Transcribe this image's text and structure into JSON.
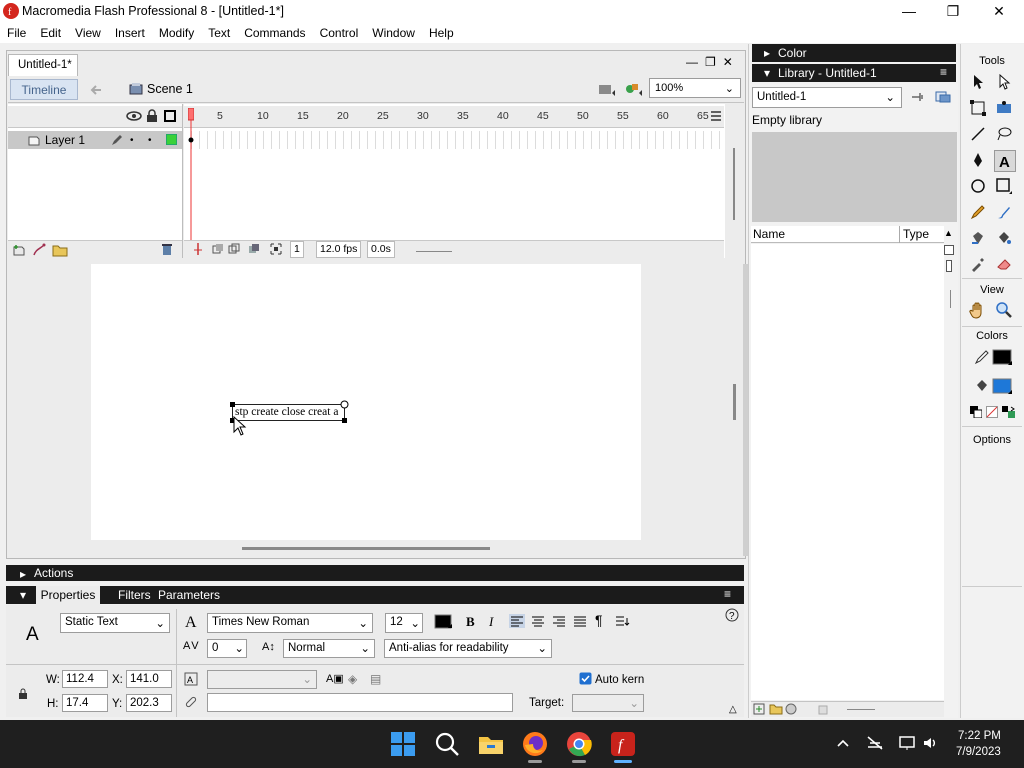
{
  "window": {
    "title": "Macromedia Flash Professional 8 - [Untitled-1*]"
  },
  "menu": [
    "File",
    "Edit",
    "View",
    "Insert",
    "Modify",
    "Text",
    "Commands",
    "Control",
    "Window",
    "Help"
  ],
  "document": {
    "tab": "Untitled-1*"
  },
  "editbar": {
    "timeline_label": "Timeline",
    "scene_label": "Scene 1",
    "zoom": "100%"
  },
  "timeline": {
    "layer_name": "Layer 1",
    "ruler_numbers": [
      "5",
      "10",
      "15",
      "20",
      "25",
      "30",
      "35",
      "40",
      "45",
      "50",
      "55",
      "60",
      "65"
    ],
    "current_frame": "1",
    "fps": "12.0 fps",
    "time": "0.0s"
  },
  "stage": {
    "text_content": "stp create close creat a"
  },
  "panels": {
    "actions": "Actions",
    "tabs": [
      "Properties",
      "Filters",
      "Parameters"
    ]
  },
  "properties": {
    "text_type": "Static Text",
    "font": "Times New Roman",
    "size": "12",
    "letter_spacing": "0",
    "baseline": "Normal",
    "antialias": "Anti-alias for readability",
    "w_label": "W:",
    "w": "112.4",
    "h_label": "H:",
    "h": "17.4",
    "x_label": "X:",
    "x": "141.0",
    "y_label": "Y:",
    "y": "202.3",
    "auto_kern": "Auto kern",
    "target_label": "Target:"
  },
  "color_panel": {
    "title": "Color"
  },
  "library": {
    "title": "Library - Untitled-1",
    "selected": "Untitled-1",
    "status": "Empty library",
    "col_name": "Name",
    "col_type": "Type"
  },
  "tools": {
    "header": "Tools",
    "view": "View",
    "colors": "Colors",
    "options": "Options"
  },
  "taskbar": {
    "time": "7:22 PM",
    "date": "7/9/2023"
  },
  "colors": {
    "accent_red": "#d4261d",
    "stroke": "#000000",
    "fill": "#1e78d8"
  }
}
